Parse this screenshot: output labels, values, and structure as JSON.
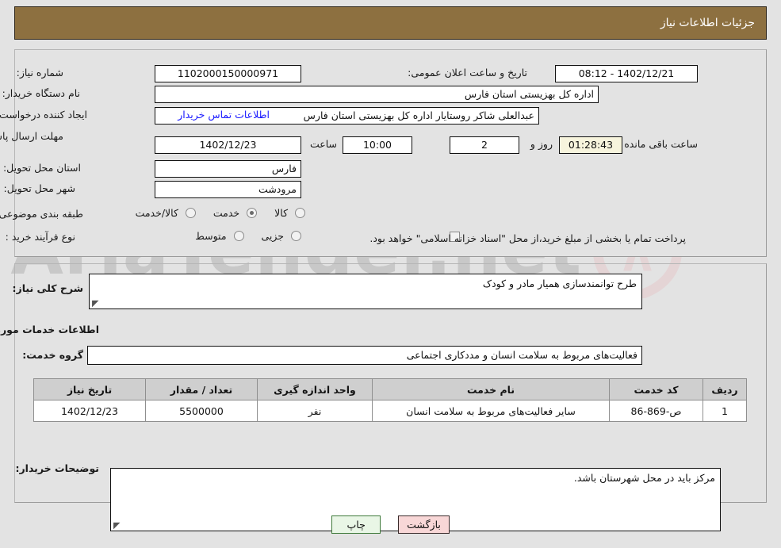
{
  "header": {
    "title": "جزئیات اطلاعات نیاز"
  },
  "form": {
    "need_number_label": "شماره نیاز:",
    "need_number_value": "1102000150000971",
    "announce_label": "تاریخ و ساعت اعلان عمومی:",
    "announce_value": "1402/12/21 - 08:12",
    "buyer_org_label": "نام دستگاه خریدار:",
    "buyer_org_value": "اداره کل بهزیستی استان فارس",
    "creator_label": "ایجاد کننده درخواست:",
    "creator_value": "عبدالعلی شاکر روستایار اداره کل بهزیستی استان فارس",
    "contact_link": "اطلاعات تماس خریدار",
    "deadline_label": "مهلت ارسال پاسخ: تا تاریخ:",
    "deadline_date": "1402/12/23",
    "hour_label": "ساعت",
    "hour_value": "10:00",
    "days_value": "2",
    "days_label": "روز و",
    "countdown_value": "01:28:43",
    "countdown_label": "ساعت باقی مانده",
    "province_label": "استان محل تحویل:",
    "province_value": "فارس",
    "city_label": "شهر محل تحویل:",
    "city_value": "مرودشت",
    "category_label": "طبقه بندی موضوعی:",
    "category_options": [
      {
        "label": "کالا",
        "selected": false
      },
      {
        "label": "خدمت",
        "selected": true
      },
      {
        "label": "کالا/خدمت",
        "selected": false
      }
    ],
    "process_label": "نوع فرآیند خرید :",
    "process_options": [
      {
        "label": "جزیی",
        "selected": false
      },
      {
        "label": "متوسط",
        "selected": false
      }
    ],
    "treasury_checked": false,
    "treasury_note": "پرداخت تمام یا بخشی از مبلغ خرید،از محل \"اسناد خزانه اسلامی\" خواهد بود."
  },
  "description": {
    "label": "شرح کلی نیاز:",
    "value": "طرح توانمندسازی همیار مادر و کودک"
  },
  "services": {
    "section_title": "اطلاعات خدمات مورد نیاز",
    "group_label": "گروه خدمت:",
    "group_value": "فعالیت‌های مربوط به سلامت انسان و مددکاری اجتماعی",
    "columns": [
      "ردیف",
      "کد خدمت",
      "نام خدمت",
      "واحد اندازه گیری",
      "تعداد / مقدار",
      "تاریخ نیاز"
    ],
    "rows": [
      {
        "row": "1",
        "code": "ص-869-86",
        "name": "سایر فعالیت‌های مربوط به سلامت انسان",
        "unit": "نفر",
        "quantity": "5500000",
        "date": "1402/12/23"
      }
    ]
  },
  "notes": {
    "label": "توضیحات خریدار:",
    "value": "مرکز باید در محل شهرستان باشد."
  },
  "buttons": {
    "back": "بازگشت",
    "print": "چاپ"
  },
  "watermark": {
    "text": "AriaTender.net"
  },
  "colors": {
    "header_bar": "#8d7040",
    "page_background": "#e3e3e3",
    "link": "#1a1aff",
    "countdown_background": "#f7f4dd",
    "back_button": "#f8d7d7",
    "print_button": "#e9f6e6",
    "table_header": "#cfcfcf"
  }
}
